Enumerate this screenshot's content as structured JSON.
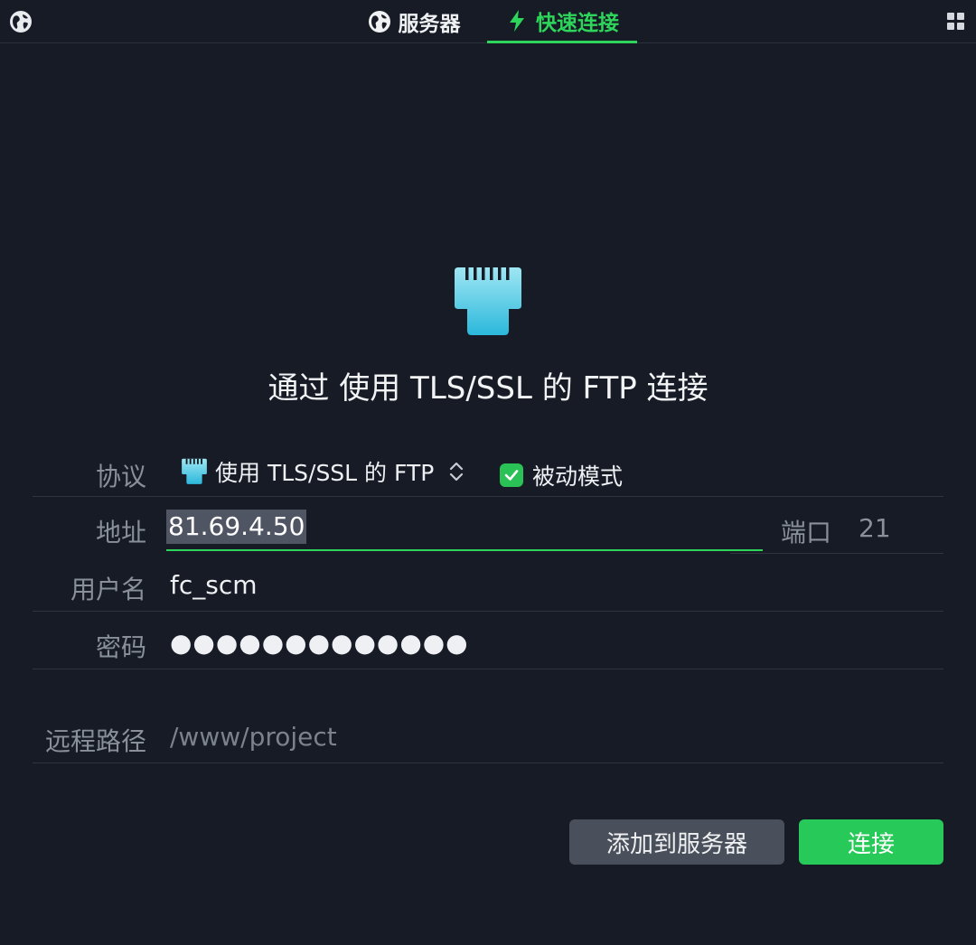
{
  "header": {
    "tabs": [
      {
        "label": "服务器",
        "icon": "globe-icon",
        "active": false
      },
      {
        "label": "快速连接",
        "icon": "lightning-icon",
        "active": true
      }
    ]
  },
  "hero": {
    "icon": "ethernet-plug-icon",
    "title": "通过 使用 TLS/SSL 的 FTP 连接"
  },
  "form": {
    "protocol_label": "协议",
    "protocol_value": "使用 TLS/SSL 的 FTP",
    "passive_label": "被动模式",
    "passive_checked": true,
    "address_label": "地址",
    "address_value": "81.69.4.50",
    "port_label": "端口",
    "port_value": "21",
    "username_label": "用户名",
    "username_value": "fc_scm",
    "password_label": "密码",
    "password_value": "●●●●●●●●●●●●●",
    "path_label": "远程路径",
    "path_placeholder": "/www/project"
  },
  "buttons": {
    "add_label": "添加到服务器",
    "connect_label": "连接"
  },
  "colors": {
    "accent": "#2dd55b",
    "background": "#161b26",
    "secondary_button": "#4a505b"
  }
}
